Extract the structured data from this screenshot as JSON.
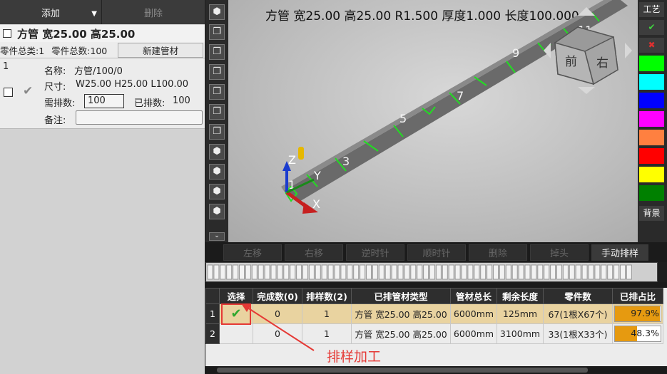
{
  "toolbar": {
    "add": "添加",
    "delete": "删除"
  },
  "pipe_header": {
    "title": "方管 宽25.00 高25.00"
  },
  "stats": {
    "category_label": "零件总类:1",
    "total_label": "零件总数:100",
    "new_pipe": "新建管材"
  },
  "part": {
    "index": "1",
    "name_label": "名称:",
    "name_value": "方管/100/0",
    "size_label": "尺寸:",
    "size_value": "W25.00 H25.00 L100.00",
    "need_label": "需排数:",
    "need_value": "100",
    "done_label": "已排数:",
    "done_value": "100",
    "note_label": "备注:",
    "note_value": ""
  },
  "viewport": {
    "info": "方管 宽25.00 高25.00 R1.500 厚度1.000 长度100.000",
    "axis_x": "X",
    "axis_y": "Y",
    "axis_z": "Z",
    "cube_front": "前",
    "cube_right": "右",
    "markers": [
      "1",
      "3",
      "5",
      "7",
      "9",
      "11"
    ]
  },
  "right_tools": {
    "process": "工艺",
    "ok": "✔",
    "cancel": "✖",
    "background": "背景",
    "colors": [
      "#00ff00",
      "#00ffff",
      "#0000ff",
      "#ff00ff",
      "#ff8040",
      "#ff0000",
      "#ffff00",
      "#008000"
    ]
  },
  "action_buttons": [
    "左移",
    "右移",
    "逆时针",
    "顺时针",
    "删除",
    "掉头",
    "手动排样"
  ],
  "table": {
    "headers": [
      "选择",
      "完成数(0)",
      "排样数(2)",
      "已排管材类型",
      "管材总长",
      "剩余长度",
      "零件数",
      "已排占比"
    ],
    "rows": [
      {
        "no": "1",
        "done": "0",
        "count": "1",
        "type": "方管 宽25.00 高25.00",
        "total": "6000mm",
        "remain": "125mm",
        "parts": "67(1根X67个)",
        "ratio": "97.9%",
        "ratio_value": 0.979
      },
      {
        "no": "2",
        "done": "0",
        "count": "1",
        "type": "方管 宽25.00 高25.00",
        "total": "6000mm",
        "remain": "3100mm",
        "parts": "33(1根X33个)",
        "ratio": "48.3%",
        "ratio_value": 0.483
      }
    ]
  },
  "annotation": "排样加工"
}
